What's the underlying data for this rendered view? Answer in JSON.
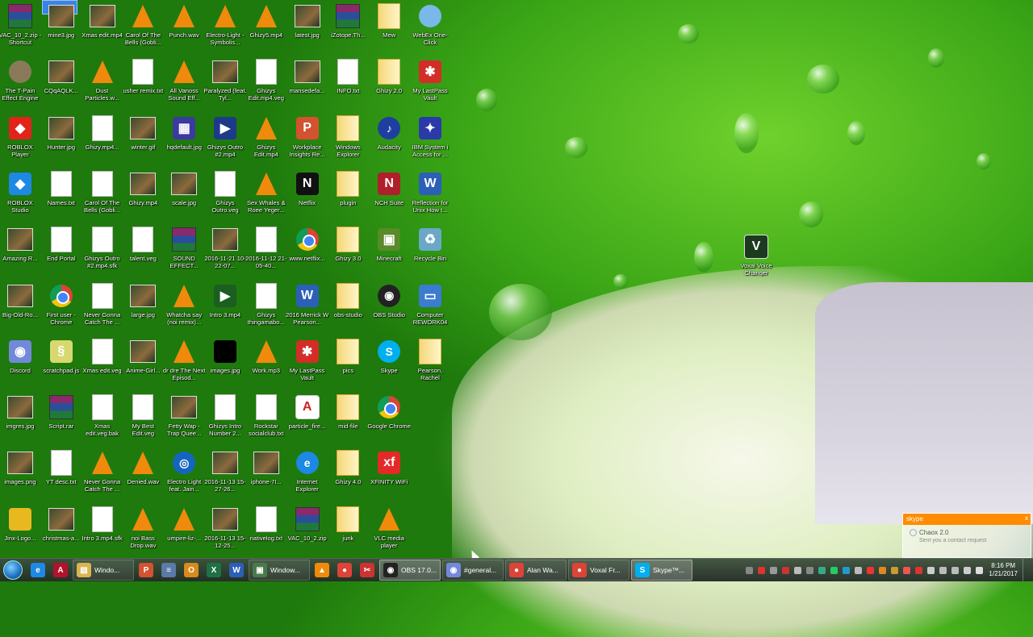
{
  "desktop": {
    "icons": [
      {
        "label": "VAC_10_2.zip - Shortcut",
        "type": "rar",
        "color": "",
        "icon": "archive-shortcut-icon"
      },
      {
        "label": "mine3.jpg",
        "type": "img",
        "color": "",
        "icon": "image-file-icon"
      },
      {
        "label": "Xmas edit.mp4",
        "type": "img",
        "color": "",
        "icon": "video-file-icon"
      },
      {
        "label": "Carol Of The Bells (Gobli...",
        "type": "vlc",
        "color": "",
        "icon": "vlc-icon"
      },
      {
        "label": "Punch.wav",
        "type": "vlc",
        "color": "",
        "icon": "vlc-icon"
      },
      {
        "label": "Electro-Light - Symbolis...",
        "type": "vlc",
        "color": "",
        "icon": "vlc-icon"
      },
      {
        "label": "Ghizy5.mp4",
        "type": "vlc",
        "color": "",
        "icon": "vlc-icon"
      },
      {
        "label": "latest.jpg",
        "type": "img",
        "color": "",
        "icon": "image-file-icon"
      },
      {
        "label": "iZotope.Th...",
        "type": "rar",
        "color": "",
        "icon": "archive-icon"
      },
      {
        "label": "Mew",
        "type": "folder",
        "color": "",
        "icon": "folder-icon"
      },
      {
        "label": "WebEx One-Click",
        "type": "round",
        "color": "#7ab8e8",
        "icon": "webex-icon",
        "glyph": ""
      },
      {
        "label": "The T-Pain Effect Engine",
        "type": "round",
        "color": "#8a7a5a",
        "icon": "tpain-icon",
        "glyph": ""
      },
      {
        "label": "CQqAQLK...",
        "type": "img",
        "color": "",
        "icon": "image-file-icon"
      },
      {
        "label": "Dust Particles.w...",
        "type": "vlc",
        "color": "",
        "icon": "vlc-icon"
      },
      {
        "label": "usher remix.txt",
        "type": "file",
        "color": "",
        "icon": "text-file-icon"
      },
      {
        "label": "All Vanoss Sound Eff...",
        "type": "vlc",
        "color": "",
        "icon": "vlc-icon"
      },
      {
        "label": "Paralyzed (feat. Tyl...",
        "type": "img",
        "color": "",
        "icon": "image-file-icon"
      },
      {
        "label": "Ghizys Edit.mp4.veg",
        "type": "file",
        "color": "",
        "icon": "veg-file-icon"
      },
      {
        "label": "mansedefa...",
        "type": "img",
        "color": "",
        "icon": "image-file-icon"
      },
      {
        "label": "INFO.txt",
        "type": "file",
        "color": "",
        "icon": "text-file-icon"
      },
      {
        "label": "Ghizy 2.0",
        "type": "folder",
        "color": "",
        "icon": "folder-icon"
      },
      {
        "label": "My LastPass Vault",
        "type": "app",
        "color": "#d32d27",
        "icon": "lastpass-icon",
        "glyph": "✱"
      },
      {
        "label": "ROBLOX Player",
        "type": "app",
        "color": "#e2231a",
        "icon": "roblox-icon",
        "glyph": "◆"
      },
      {
        "label": "Hunter.jpg",
        "type": "img",
        "color": "",
        "icon": "image-file-icon"
      },
      {
        "label": "Ghizy.mp4...",
        "type": "file",
        "color": "",
        "icon": "file-icon"
      },
      {
        "label": "winter.gif",
        "type": "img",
        "color": "",
        "icon": "image-file-icon"
      },
      {
        "label": "hqdefault.jpg",
        "type": "app",
        "color": "#3a3aa0",
        "icon": "image-file-icon",
        "glyph": "▦"
      },
      {
        "label": "Ghizys Outro #2.mp4",
        "type": "app",
        "color": "#1d3a8a",
        "icon": "video-file-icon",
        "glyph": "▶"
      },
      {
        "label": "Ghizys Edit.mp4",
        "type": "vlc",
        "color": "",
        "icon": "vlc-icon"
      },
      {
        "label": "Workplace Insights Re...",
        "type": "app",
        "color": "#d35230",
        "icon": "powerpoint-icon",
        "glyph": "P"
      },
      {
        "label": "Windows Explorer",
        "type": "folder",
        "color": "",
        "icon": "folder-icon"
      },
      {
        "label": "Audacity",
        "type": "round",
        "color": "#1f3fa0",
        "icon": "audacity-icon",
        "glyph": "♪"
      },
      {
        "label": "IBM System i Access for ...",
        "type": "app",
        "color": "#2a3aa8",
        "icon": "ibm-icon",
        "glyph": "✦"
      },
      {
        "label": "ROBLOX Studio",
        "type": "app",
        "color": "#1e88e5",
        "icon": "roblox-studio-icon",
        "glyph": "◆"
      },
      {
        "label": "Names.txt",
        "type": "file",
        "color": "",
        "icon": "text-file-icon"
      },
      {
        "label": "Carol Of The Bells (Gobli...",
        "type": "file",
        "color": "",
        "icon": "file-icon"
      },
      {
        "label": "Ghizy.mp4",
        "type": "img",
        "color": "",
        "icon": "video-file-icon"
      },
      {
        "label": "scale.jpg",
        "type": "img",
        "color": "",
        "icon": "image-file-icon"
      },
      {
        "label": "Ghizys Outro.veg",
        "type": "file",
        "color": "",
        "icon": "veg-file-icon"
      },
      {
        "label": "Sex Whales & Roee Yeger...",
        "type": "vlc",
        "color": "",
        "icon": "vlc-icon"
      },
      {
        "label": "Netflix",
        "type": "app",
        "color": "#111",
        "icon": "netflix-icon",
        "glyph": "N"
      },
      {
        "label": "plugin",
        "type": "folder",
        "color": "",
        "icon": "folder-icon"
      },
      {
        "label": "NCH Suite",
        "type": "app",
        "color": "#b0202a",
        "icon": "nch-icon",
        "glyph": "N"
      },
      {
        "label": "Reflection for Unix How t...",
        "type": "app",
        "color": "#2b5fb8",
        "icon": "word-icon",
        "glyph": "W"
      },
      {
        "label": "Amazing R...",
        "type": "img",
        "color": "",
        "icon": "image-file-icon"
      },
      {
        "label": "End Portal",
        "type": "file",
        "color": "",
        "icon": "file-icon"
      },
      {
        "label": "Ghizys Outro #2.mp4.sfk",
        "type": "file",
        "color": "",
        "icon": "file-icon"
      },
      {
        "label": "talent.veg",
        "type": "file",
        "color": "",
        "icon": "veg-file-icon"
      },
      {
        "label": "SOUND EFFECT...",
        "type": "rar",
        "color": "",
        "icon": "archive-icon"
      },
      {
        "label": "2016-11-21 10-22-07...",
        "type": "img",
        "color": "",
        "icon": "video-file-icon"
      },
      {
        "label": "2016-11-12 21-05-40...",
        "type": "file",
        "color": "",
        "icon": "file-icon"
      },
      {
        "label": "www.netflix...",
        "type": "chrome",
        "color": "",
        "icon": "chrome-icon"
      },
      {
        "label": "Ghizy 3.0",
        "type": "folder",
        "color": "",
        "icon": "folder-icon"
      },
      {
        "label": "Minecraft",
        "type": "app",
        "color": "#5a8a2a",
        "icon": "minecraft-icon",
        "glyph": "▣"
      },
      {
        "label": "Recycle Bin",
        "type": "app",
        "color": "#6aa8c8",
        "icon": "recycle-bin-icon",
        "glyph": "♻"
      },
      {
        "label": "Big-Old-Ro...",
        "type": "img",
        "color": "",
        "icon": "image-file-icon"
      },
      {
        "label": "First user - Chrome",
        "type": "chrome",
        "color": "",
        "icon": "chrome-icon"
      },
      {
        "label": "Never Gonna Catch The ...",
        "type": "file",
        "color": "",
        "icon": "file-icon"
      },
      {
        "label": "large.jpg",
        "type": "img",
        "color": "",
        "icon": "image-file-icon"
      },
      {
        "label": "Whatcha say (noi remix)...",
        "type": "vlc",
        "color": "",
        "icon": "vlc-icon"
      },
      {
        "label": "Intro 3.mp4",
        "type": "app",
        "color": "#1b5e20",
        "icon": "video-file-icon",
        "glyph": "▶"
      },
      {
        "label": "Ghizys thingamabo...",
        "type": "file",
        "color": "",
        "icon": "file-icon"
      },
      {
        "label": "2016 Merrick W Pearson...",
        "type": "app",
        "color": "#2b5fb8",
        "icon": "word-icon",
        "glyph": "W"
      },
      {
        "label": "obs-studio",
        "type": "folder",
        "color": "",
        "icon": "folder-icon"
      },
      {
        "label": "OBS Studio",
        "type": "round",
        "color": "#222",
        "icon": "obs-icon",
        "glyph": "◉"
      },
      {
        "label": "Computer REWORK04",
        "type": "app",
        "color": "#3b7bd0",
        "icon": "computer-icon",
        "glyph": "▭"
      },
      {
        "label": "Discord",
        "type": "app",
        "color": "#7289da",
        "icon": "discord-icon",
        "glyph": "◉"
      },
      {
        "label": "scratchpad.js",
        "type": "app",
        "color": "#d8d870",
        "icon": "script-file-icon",
        "glyph": "§"
      },
      {
        "label": "Xmas edit.veg",
        "type": "file",
        "color": "",
        "icon": "veg-file-icon"
      },
      {
        "label": "Anime-Girl...",
        "type": "img",
        "color": "",
        "icon": "image-file-icon"
      },
      {
        "label": "dr dre The Next Episod...",
        "type": "vlc",
        "color": "",
        "icon": "vlc-icon"
      },
      {
        "label": "images.jpg",
        "type": "app",
        "color": "#000",
        "icon": "image-file-icon",
        "glyph": ""
      },
      {
        "label": "Work.mp3",
        "type": "vlc",
        "color": "",
        "icon": "vlc-icon"
      },
      {
        "label": "My LastPass Vault",
        "type": "app",
        "color": "#d32d27",
        "icon": "lastpass-icon",
        "glyph": "✱"
      },
      {
        "label": "pics",
        "type": "folder",
        "color": "",
        "icon": "folder-icon"
      },
      {
        "label": "Skype",
        "type": "round",
        "color": "#00aff0",
        "icon": "skype-icon",
        "glyph": "S"
      },
      {
        "label": "Pearson, Rachel",
        "type": "folder",
        "color": "",
        "icon": "folder-icon"
      },
      {
        "label": "imgres.jpg",
        "type": "img",
        "color": "",
        "icon": "image-file-icon"
      },
      {
        "label": "Script.rar",
        "type": "rar",
        "color": "",
        "icon": "archive-icon"
      },
      {
        "label": "Xmas edit.veg.bak",
        "type": "file",
        "color": "",
        "icon": "file-icon"
      },
      {
        "label": "My Best Edit.veg",
        "type": "file",
        "color": "",
        "icon": "veg-file-icon"
      },
      {
        "label": "Fetty Wap - Trap Quee...",
        "type": "img",
        "color": "",
        "icon": "image-file-icon"
      },
      {
        "label": "Ghizys Intro Number 2...",
        "type": "file",
        "color": "",
        "icon": "file-icon"
      },
      {
        "label": "Rockstar socialclub.txt",
        "type": "file",
        "color": "",
        "icon": "text-file-icon"
      },
      {
        "label": "particle_fire...",
        "type": "app",
        "color": "#ffffff",
        "icon": "pdf-file-icon",
        "glyph": "A"
      },
      {
        "label": "mid-file",
        "type": "folder",
        "color": "",
        "icon": "folder-icon"
      },
      {
        "label": "Google Chrome",
        "type": "chrome",
        "color": "",
        "icon": "chrome-icon"
      },
      {
        "label": "",
        "type": "none",
        "color": "",
        "icon": ""
      },
      {
        "label": "images.png",
        "type": "img",
        "color": "",
        "icon": "image-file-icon"
      },
      {
        "label": "YT desc.txt",
        "type": "file",
        "color": "",
        "icon": "text-file-icon"
      },
      {
        "label": "Never Gonna Catch The ...",
        "type": "vlc",
        "color": "",
        "icon": "vlc-icon"
      },
      {
        "label": "Denied.wav",
        "type": "vlc",
        "color": "",
        "icon": "vlc-icon"
      },
      {
        "label": "Electro Light feat. Jain...",
        "type": "round",
        "color": "#1565c0",
        "icon": "audio-file-icon",
        "glyph": "◎"
      },
      {
        "label": "2016-11-13 15-27-26...",
        "type": "img",
        "color": "",
        "icon": "video-file-icon"
      },
      {
        "label": "iphone-7I...",
        "type": "img",
        "color": "",
        "icon": "image-file-icon"
      },
      {
        "label": "Internet Explorer",
        "type": "round",
        "color": "#1e88e5",
        "icon": "internet-explorer-icon",
        "glyph": "e"
      },
      {
        "label": "Ghizy 4.0",
        "type": "folder",
        "color": "",
        "icon": "folder-icon"
      },
      {
        "label": "XFINITY WiFi",
        "type": "app",
        "color": "#e32a27",
        "icon": "xfinity-icon",
        "glyph": "xf"
      },
      {
        "label": "",
        "type": "none",
        "color": "",
        "icon": ""
      },
      {
        "label": "Jinx-Logo...",
        "type": "app",
        "color": "#e8b820",
        "icon": "image-file-icon",
        "glyph": ""
      },
      {
        "label": "christmas-a...",
        "type": "img",
        "color": "",
        "icon": "image-file-icon"
      },
      {
        "label": "Intro 3.mp4.sfk",
        "type": "file",
        "color": "",
        "icon": "file-icon"
      },
      {
        "label": "noi Bass Drop.wav",
        "type": "vlc",
        "color": "",
        "icon": "vlc-icon"
      },
      {
        "label": "umpire-liz-...",
        "type": "vlc",
        "color": "",
        "icon": "vlc-icon"
      },
      {
        "label": "2016-11-13 15-12-25...",
        "type": "img",
        "color": "",
        "icon": "video-file-icon"
      },
      {
        "label": "nativelog.txt",
        "type": "file",
        "color": "",
        "icon": "text-file-icon"
      },
      {
        "label": "VAC_10_2.zip",
        "type": "rar",
        "color": "",
        "icon": "archive-icon"
      },
      {
        "label": "junk",
        "type": "folder",
        "color": "",
        "icon": "folder-icon"
      },
      {
        "label": "VLC media player",
        "type": "vlc",
        "color": "",
        "icon": "vlc-icon"
      },
      {
        "label": "",
        "type": "none",
        "color": "",
        "icon": ""
      }
    ],
    "right_icon": {
      "label": "Voxal Voice Changer",
      "glyph": "V",
      "color": "#1b5e20"
    }
  },
  "notification": {
    "app": "skype",
    "name": "Chaox 2.0",
    "message": "Sent you a contact request",
    "close": "x"
  },
  "taskbar": {
    "start_label": "",
    "items": [
      {
        "label": "",
        "icon": "internet-explorer-icon",
        "glyph": "e",
        "color": "#1e88e5",
        "wide": false
      },
      {
        "label": "",
        "icon": "adobe-icon",
        "glyph": "A",
        "color": "#b3122a",
        "wide": false
      },
      {
        "label": "Windo...",
        "icon": "folder-icon",
        "glyph": "▤",
        "color": "#d8b550",
        "wide": true,
        "active": false
      },
      {
        "label": "",
        "icon": "powerpoint-icon",
        "glyph": "P",
        "color": "#d35230",
        "wide": false
      },
      {
        "label": "",
        "icon": "notepad-icon",
        "glyph": "≡",
        "color": "#5a7aa8",
        "wide": false
      },
      {
        "label": "",
        "icon": "outlook-icon",
        "glyph": "O",
        "color": "#d88a1a",
        "wide": false
      },
      {
        "label": "",
        "icon": "excel-icon",
        "glyph": "X",
        "color": "#1e7145",
        "wide": false
      },
      {
        "label": "",
        "icon": "word-icon",
        "glyph": "W",
        "color": "#2b5fb8",
        "wide": false
      },
      {
        "label": "Window...",
        "icon": "window-icon",
        "glyph": "▣",
        "color": "#4a7a4a",
        "wide": true,
        "active": false
      },
      {
        "label": "",
        "icon": "vlc-icon",
        "glyph": "▲",
        "color": "#f08a0c",
        "wide": false
      },
      {
        "label": "",
        "icon": "chrome-icon",
        "glyph": "●",
        "color": "#db4437",
        "wide": false
      },
      {
        "label": "",
        "icon": "snipping-icon",
        "glyph": "✂",
        "color": "#c33",
        "wide": false
      },
      {
        "label": "OBS 17.0...",
        "icon": "obs-icon",
        "glyph": "◉",
        "color": "#222",
        "wide": true,
        "active": true
      },
      {
        "label": "#general...",
        "icon": "discord-icon",
        "glyph": "◉",
        "color": "#7289da",
        "wide": true,
        "active": false
      },
      {
        "label": "Alan Wa...",
        "icon": "chrome-icon",
        "glyph": "●",
        "color": "#db4437",
        "wide": true,
        "active": false
      },
      {
        "label": "Voxal Fr...",
        "icon": "chrome-icon",
        "glyph": "●",
        "color": "#db4437",
        "wide": true,
        "active": false
      },
      {
        "label": "Skype™...",
        "icon": "skype-icon",
        "glyph": "S",
        "color": "#00aff0",
        "wide": true,
        "active": true
      }
    ],
    "tray_colors": [
      "#888",
      "#d33",
      "#999",
      "#c33",
      "#bbb",
      "#888",
      "#3a8",
      "#2c6",
      "#29c",
      "#bbb",
      "#e33",
      "#d82",
      "#c93",
      "#e55",
      "#d33",
      "#ccc",
      "#bbb",
      "#bbb",
      "#ccc",
      "#ddd"
    ],
    "time": "8:16 PM",
    "date": "1/21/2017"
  }
}
